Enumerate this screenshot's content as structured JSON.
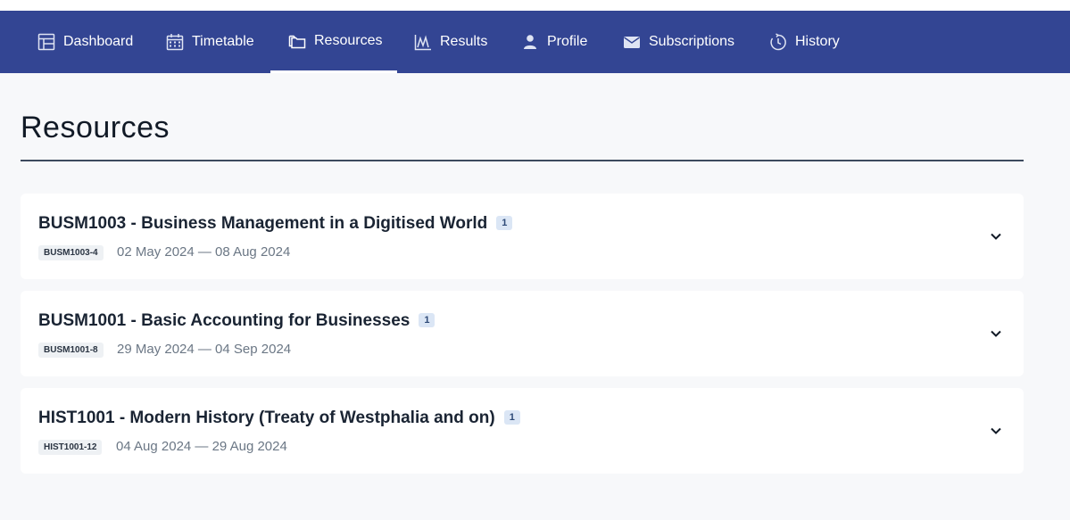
{
  "nav": {
    "items": [
      {
        "label": "Dashboard",
        "icon": "dashboard-icon"
      },
      {
        "label": "Timetable",
        "icon": "calendar-icon"
      },
      {
        "label": "Resources",
        "icon": "folders-icon"
      },
      {
        "label": "Results",
        "icon": "chart-icon"
      },
      {
        "label": "Profile",
        "icon": "person-icon"
      },
      {
        "label": "Subscriptions",
        "icon": "envelope-icon"
      },
      {
        "label": "History",
        "icon": "history-icon"
      }
    ],
    "active": "Resources",
    "colors": {
      "background": "#334593",
      "text": "#ffffff"
    }
  },
  "page": {
    "title": "Resources"
  },
  "courses": [
    {
      "title": "BUSM1003 - Business Management in a Digitised World",
      "count": "1",
      "code": "BUSM1003-4",
      "dates": "02 May 2024 — 08 Aug 2024"
    },
    {
      "title": "BUSM1001 - Basic Accounting for Businesses",
      "count": "1",
      "code": "BUSM1001-8",
      "dates": "29 May 2024 — 04 Sep 2024"
    },
    {
      "title": "HIST1001 - Modern History (Treaty of Westphalia and on)",
      "count": "1",
      "code": "HIST1001-12",
      "dates": "04 Aug 2024 — 29 Aug 2024"
    }
  ]
}
